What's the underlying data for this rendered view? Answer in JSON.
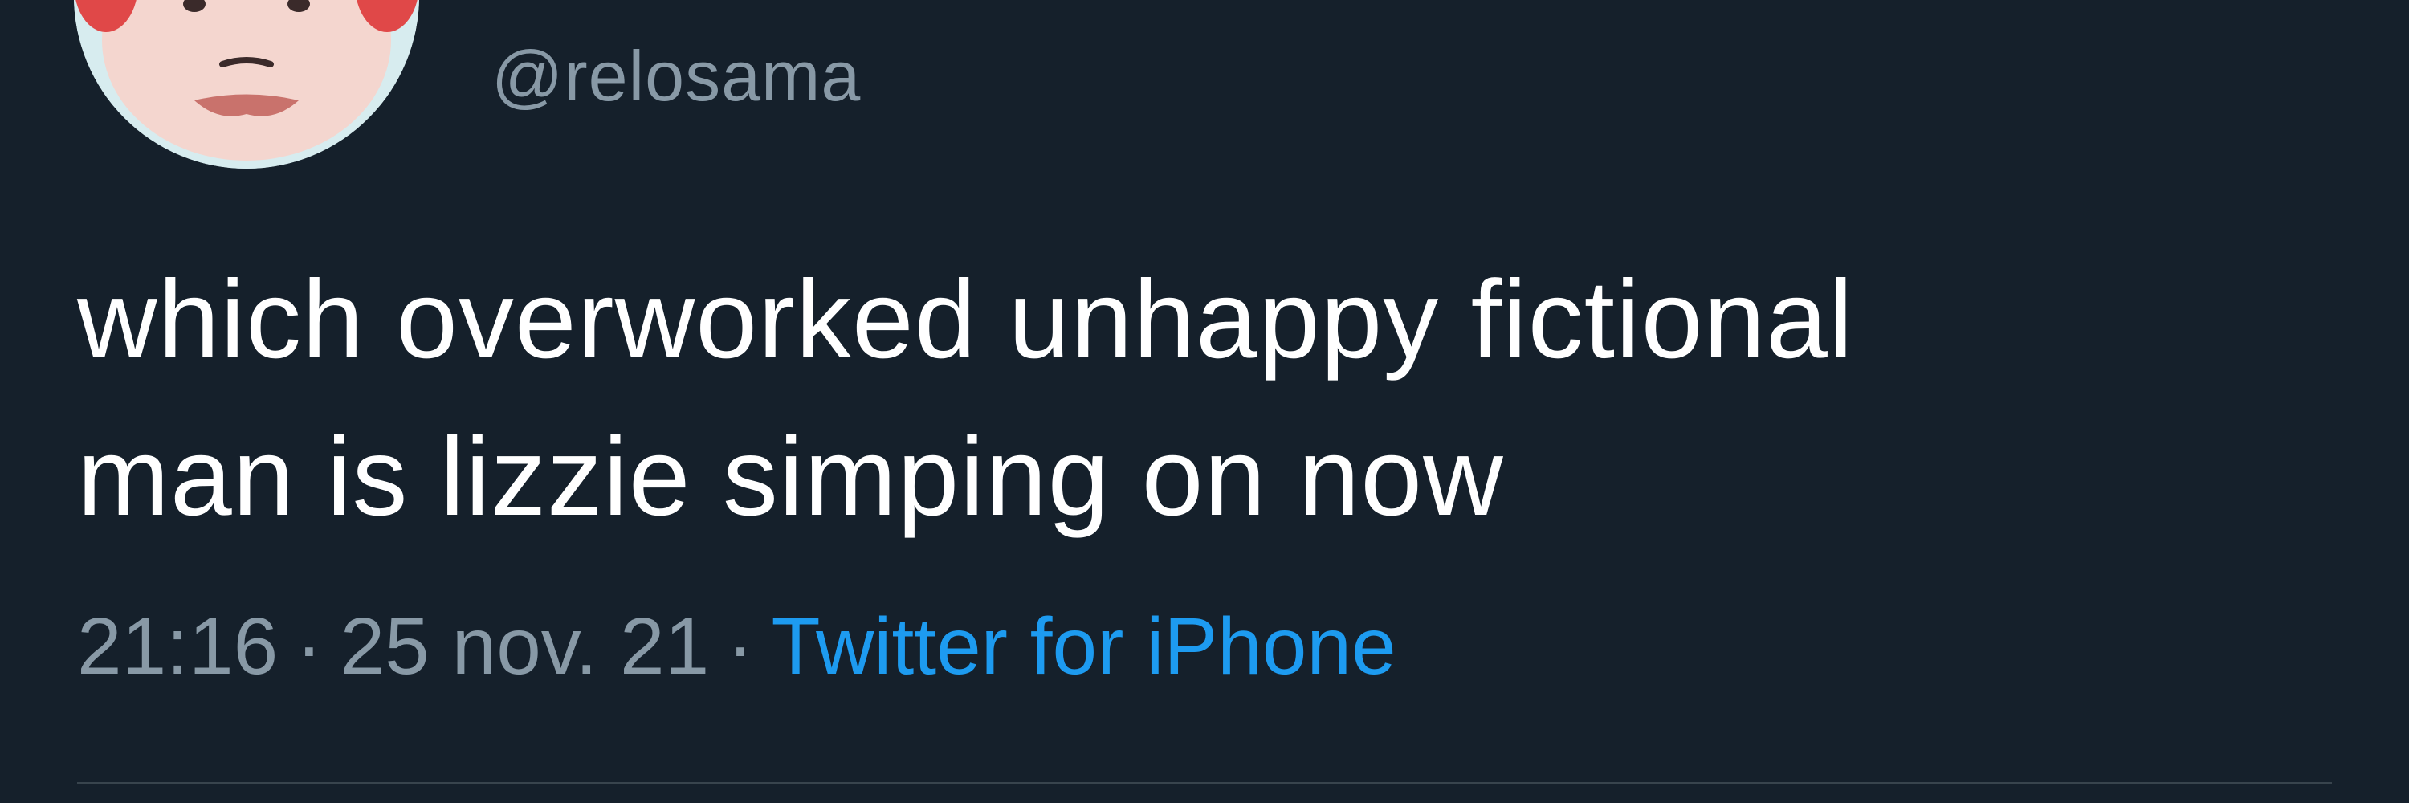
{
  "tweet": {
    "handle": "@relosama",
    "text_lines": [
      "which overworked unhappy fictional",
      "man is lizzie simping on now"
    ],
    "time": "21:16",
    "date": "25 nov. 21",
    "separator": "·",
    "source": "Twitter for iPhone",
    "avatar_icon": "animal-crossing-villager-avatar"
  },
  "colors": {
    "background": "#15202b",
    "text": "#ffffff",
    "muted": "#8899a6",
    "link": "#1d9bf0",
    "divider": "#38444d"
  }
}
